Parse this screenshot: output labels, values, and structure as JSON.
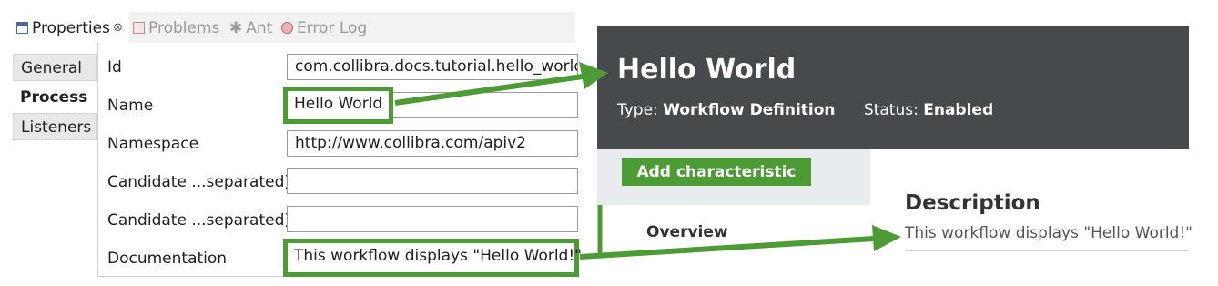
{
  "properties_view": {
    "tabs": [
      {
        "label": "Properties",
        "close_glyph": "⊗",
        "icon": "properties-icon"
      },
      {
        "label": "Problems",
        "icon": "problems-icon"
      },
      {
        "label": "Ant",
        "icon": "ant-icon"
      },
      {
        "label": "Error Log",
        "icon": "error-log-icon"
      }
    ],
    "side_tabs": [
      "General",
      "Process",
      "Listeners"
    ],
    "selected_side_tab": "Process",
    "fields": [
      {
        "label": "Id",
        "value": "com.collibra.docs.tutorial.hello_world"
      },
      {
        "label": "Name",
        "value": "Hello World"
      },
      {
        "label": "Namespace",
        "value": "http://www.collibra.com/apiv2"
      },
      {
        "label": "Candidate ...separated)",
        "value": ""
      },
      {
        "label": "Candidate ...separated)",
        "value": ""
      },
      {
        "label": "Documentation",
        "value": "This workflow displays \"Hello World!\""
      }
    ]
  },
  "workflow_page": {
    "title": "Hello World",
    "type_label": "Type:",
    "type_value": "Workflow Definition",
    "status_label": "Status:",
    "status_value": "Enabled",
    "add_characteristic_label": "Add characteristic",
    "overview_label": "Overview",
    "description_heading": "Description",
    "description_text": "This workflow displays \"Hello World!\""
  },
  "colors": {
    "highlight_green": "#4d9b34",
    "header_bg": "#474a4d",
    "button_green": "#4d9b34"
  }
}
